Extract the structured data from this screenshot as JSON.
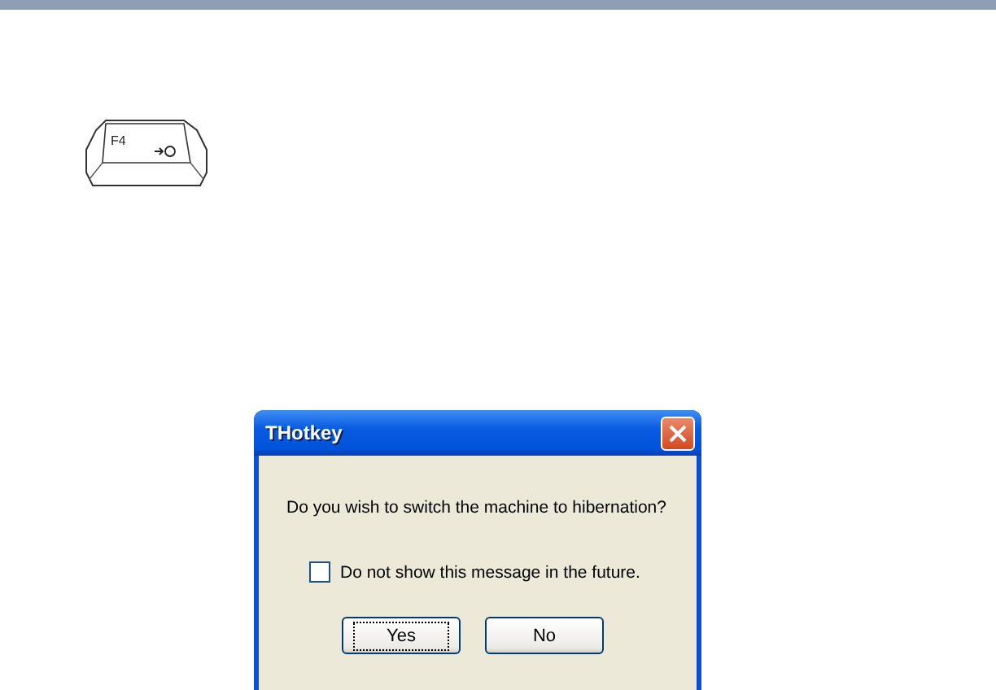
{
  "key": {
    "label": "F4"
  },
  "dialog": {
    "title": "THotkey",
    "message": "Do you wish to switch the machine to hibernation?",
    "checkbox": {
      "label": "Do not show this message in the future.",
      "checked": false
    },
    "buttons": [
      {
        "label": "Yes",
        "focused": true
      },
      {
        "label": "No",
        "focused": false
      }
    ]
  }
}
